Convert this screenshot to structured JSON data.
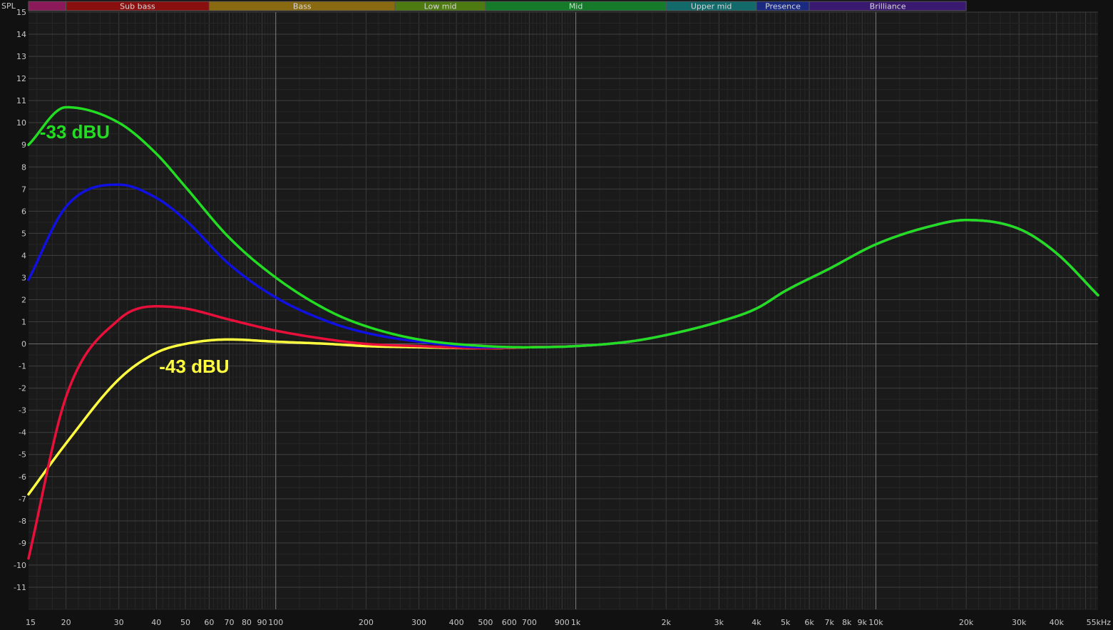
{
  "chart_data": {
    "type": "line",
    "title": "",
    "ylabel": "SPL",
    "xlabel": "",
    "x_scale": "log",
    "xlim": [
      15,
      55000
    ],
    "ylim": [
      -12,
      15
    ],
    "grid": true,
    "x_tick_labels": [
      {
        "value": 15,
        "label": "15"
      },
      {
        "value": 20,
        "label": "20"
      },
      {
        "value": 30,
        "label": "30"
      },
      {
        "value": 40,
        "label": "40"
      },
      {
        "value": 50,
        "label": "50"
      },
      {
        "value": 60,
        "label": "60"
      },
      {
        "value": 70,
        "label": "70"
      },
      {
        "value": 80,
        "label": "80"
      },
      {
        "value": 90,
        "label": "90"
      },
      {
        "value": 100,
        "label": "100"
      },
      {
        "value": 200,
        "label": "200"
      },
      {
        "value": 300,
        "label": "300"
      },
      {
        "value": 400,
        "label": "400"
      },
      {
        "value": 500,
        "label": "500"
      },
      {
        "value": 600,
        "label": "600"
      },
      {
        "value": 700,
        "label": "700"
      },
      {
        "value": 900,
        "label": "900"
      },
      {
        "value": 1000,
        "label": "1k"
      },
      {
        "value": 2000,
        "label": "2k"
      },
      {
        "value": 3000,
        "label": "3k"
      },
      {
        "value": 4000,
        "label": "4k"
      },
      {
        "value": 5000,
        "label": "5k"
      },
      {
        "value": 6000,
        "label": "6k"
      },
      {
        "value": 7000,
        "label": "7k"
      },
      {
        "value": 8000,
        "label": "8k"
      },
      {
        "value": 9000,
        "label": "9k"
      },
      {
        "value": 10000,
        "label": "10k"
      },
      {
        "value": 20000,
        "label": "20k"
      },
      {
        "value": 30000,
        "label": "30k"
      },
      {
        "value": 40000,
        "label": "40k"
      },
      {
        "value": 55000,
        "label": "55kHz"
      }
    ],
    "y_ticks": [
      15,
      14,
      13,
      12,
      11,
      10,
      9,
      8,
      7,
      6,
      5,
      4,
      3,
      2,
      1,
      0,
      -1,
      -2,
      -3,
      -4,
      -5,
      -6,
      -7,
      -8,
      -9,
      -10,
      -11
    ],
    "bands": [
      {
        "label": "",
        "from": 15,
        "to": 20,
        "color": "#8c1a5a"
      },
      {
        "label": "Sub bass",
        "from": 20,
        "to": 60,
        "color": "#8a1010"
      },
      {
        "label": "Bass",
        "from": 60,
        "to": 250,
        "color": "#8a6a10"
      },
      {
        "label": "Low mid",
        "from": 250,
        "to": 500,
        "color": "#4e7a12"
      },
      {
        "label": "Mid",
        "from": 500,
        "to": 2000,
        "color": "#157a2a"
      },
      {
        "label": "Upper mid",
        "from": 2000,
        "to": 4000,
        "color": "#126a6a"
      },
      {
        "label": "Presence",
        "from": 4000,
        "to": 6000,
        "color": "#1a2a80"
      },
      {
        "label": "Brilliance",
        "from": 6000,
        "to": 20000,
        "color": "#3a1a70"
      }
    ],
    "series": [
      {
        "color": "#ffff40",
        "points": [
          [
            15,
            -6.8
          ],
          [
            20,
            -4.5
          ],
          [
            30,
            -1.6
          ],
          [
            40,
            -0.4
          ],
          [
            50,
            0.0
          ],
          [
            70,
            0.2
          ],
          [
            100,
            0.1
          ],
          [
            150,
            0.0
          ],
          [
            200,
            -0.1
          ],
          [
            300,
            -0.15
          ],
          [
            500,
            -0.2
          ],
          [
            700,
            -0.15
          ],
          [
            1000,
            -0.1
          ],
          [
            1500,
            0.1
          ],
          [
            2000,
            0.4
          ],
          [
            3000,
            1.0
          ],
          [
            4000,
            1.6
          ],
          [
            5000,
            2.4
          ],
          [
            7000,
            3.4
          ],
          [
            10000,
            4.5
          ],
          [
            15000,
            5.3
          ],
          [
            20000,
            5.6
          ],
          [
            30000,
            5.2
          ],
          [
            40000,
            4.1
          ],
          [
            55000,
            2.2
          ]
        ]
      },
      {
        "color": "#e8103a",
        "points": [
          [
            15,
            -9.7
          ],
          [
            20,
            -2.4
          ],
          [
            30,
            1.1
          ],
          [
            40,
            1.7
          ],
          [
            50,
            1.6
          ],
          [
            70,
            1.1
          ],
          [
            100,
            0.6
          ],
          [
            150,
            0.2
          ],
          [
            200,
            0.0
          ],
          [
            300,
            -0.1
          ],
          [
            500,
            -0.2
          ],
          [
            700,
            -0.15
          ],
          [
            1000,
            -0.1
          ],
          [
            1500,
            0.1
          ],
          [
            2000,
            0.4
          ],
          [
            3000,
            1.0
          ],
          [
            4000,
            1.6
          ],
          [
            5000,
            2.4
          ],
          [
            7000,
            3.4
          ],
          [
            10000,
            4.5
          ],
          [
            15000,
            5.3
          ],
          [
            20000,
            5.6
          ],
          [
            30000,
            5.2
          ],
          [
            40000,
            4.1
          ],
          [
            55000,
            2.2
          ]
        ]
      },
      {
        "color": "#1010e0",
        "points": [
          [
            15,
            2.9
          ],
          [
            20,
            6.2
          ],
          [
            30,
            7.2
          ],
          [
            40,
            6.6
          ],
          [
            50,
            5.6
          ],
          [
            70,
            3.6
          ],
          [
            100,
            2.1
          ],
          [
            150,
            1.0
          ],
          [
            200,
            0.5
          ],
          [
            300,
            0.1
          ],
          [
            500,
            -0.15
          ],
          [
            700,
            -0.15
          ],
          [
            1000,
            -0.1
          ],
          [
            1500,
            0.1
          ],
          [
            2000,
            0.4
          ],
          [
            3000,
            1.0
          ],
          [
            4000,
            1.6
          ],
          [
            5000,
            2.4
          ],
          [
            7000,
            3.4
          ],
          [
            10000,
            4.5
          ],
          [
            15000,
            5.3
          ],
          [
            20000,
            5.6
          ],
          [
            30000,
            5.2
          ],
          [
            40000,
            4.1
          ],
          [
            55000,
            2.2
          ]
        ]
      },
      {
        "color": "#22dd22",
        "points": [
          [
            15,
            9.0
          ],
          [
            20,
            10.7
          ],
          [
            30,
            10.0
          ],
          [
            40,
            8.6
          ],
          [
            50,
            7.1
          ],
          [
            70,
            4.8
          ],
          [
            100,
            3.0
          ],
          [
            150,
            1.5
          ],
          [
            200,
            0.8
          ],
          [
            300,
            0.2
          ],
          [
            500,
            -0.1
          ],
          [
            700,
            -0.15
          ],
          [
            1000,
            -0.1
          ],
          [
            1500,
            0.1
          ],
          [
            2000,
            0.4
          ],
          [
            3000,
            1.0
          ],
          [
            4000,
            1.6
          ],
          [
            5000,
            2.4
          ],
          [
            7000,
            3.4
          ],
          [
            10000,
            4.5
          ],
          [
            15000,
            5.3
          ],
          [
            20000,
            5.6
          ],
          [
            30000,
            5.2
          ],
          [
            40000,
            4.1
          ],
          [
            55000,
            2.2
          ]
        ]
      }
    ],
    "annotations": [
      {
        "text": "-33 dBU",
        "color": "#22dd22",
        "x": 16,
        "y": 9.3
      },
      {
        "text": "-43 dBU",
        "color": "#ffff40",
        "x": 40,
        "y": -1.3
      }
    ]
  }
}
